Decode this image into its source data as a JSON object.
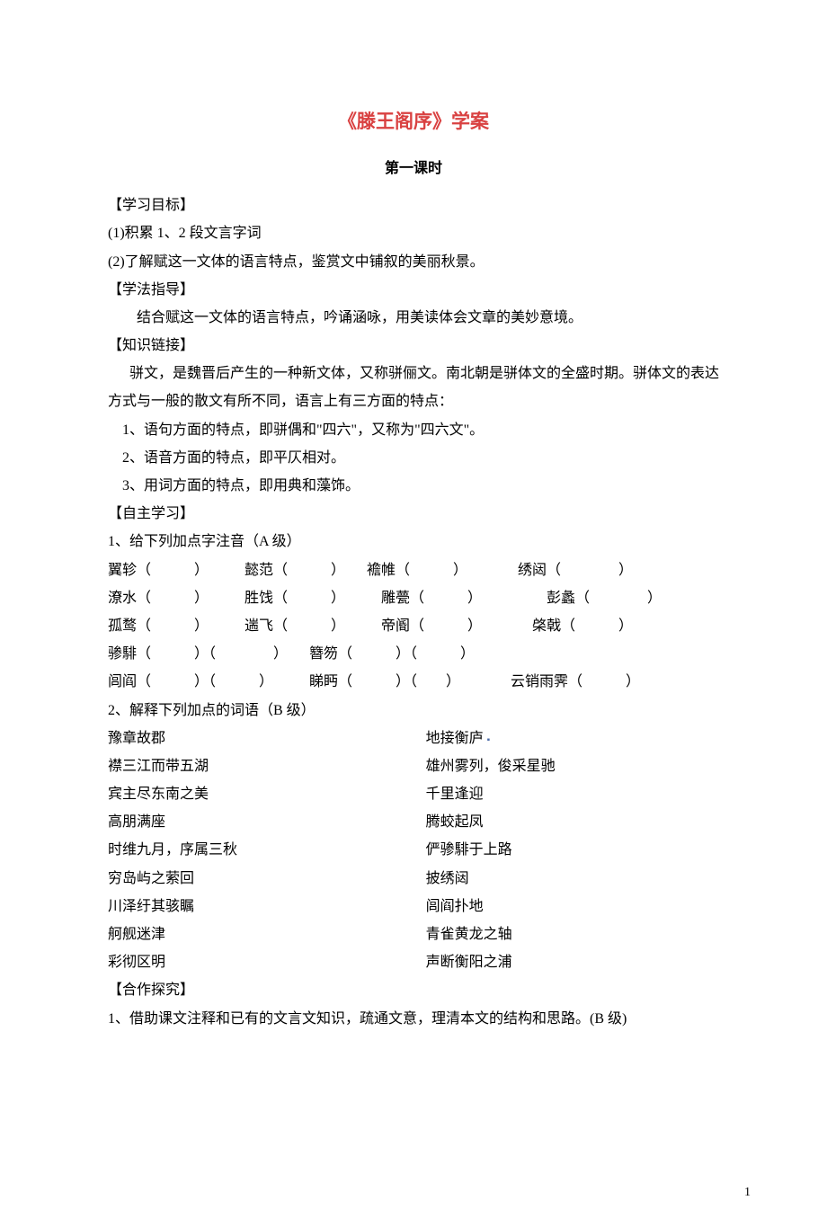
{
  "title": "《滕王阁序》学案",
  "subtitle": "第一课时",
  "headings": {
    "goals": "【学习目标】",
    "method": "【学法指导】",
    "knowledge": "【知识链接】",
    "self": "【自主学习】",
    "collab": "【合作探究】"
  },
  "goals": {
    "item1": "(1)积累 1、2 段文言字词",
    "item2": "(2)了解赋这一文体的语言特点，鉴赏文中铺叙的美丽秋景。"
  },
  "method": {
    "text": "结合赋这一文体的语言特点，吟诵涵咏，用美读体会文章的美妙意境。"
  },
  "knowledge": {
    "intro": "骈文，是魏晋后产生的一种新文体，又称骈俪文。南北朝是骈体文的全盛时期。骈体文的表达方式与一般的散文有所不同，语言上有三方面的特点：",
    "point1": "1、语句方面的特点，即骈偶和\"四六\"，又称为\"四六文\"。",
    "point2": "2、语音方面的特点，即平仄相对。",
    "point3": "3、用词方面的特点，即用典和藻饰。"
  },
  "self": {
    "prompt1": "1、给下列加点字注音（A 级）",
    "pinyin": {
      "r1": "翼轸（　　　）　　　懿范（　　　）　　襜帷（　　　）　　　　绣闼（　　　　）",
      "r2": "潦水（　　　）　　　胜饯（　　　）　　　雕甍（　　　）　　　　　彭蠡（　　　　）",
      "r3": "孤鹜（　　　）　　　遄飞（　　　）　　　帝阍（　　　）　　　　棨戟（　　　）",
      "r4": "骖騑（　　　）（　　　　）　　簪笏（　　　）（　　　）",
      "r5": "闾阎（　　　）（　　　）　　　睇眄（　　　）（　　）　　　　云销雨霁（　　　）"
    },
    "prompt2": "2、解释下列加点的词语（B 级）",
    "explain": [
      {
        "l": "豫章故郡",
        "r": "地接衡庐"
      },
      {
        "l": "襟三江而带五湖",
        "r": "雄州雾列，俊采星驰"
      },
      {
        "l": "宾主尽东南之美",
        "r": "千里逢迎"
      },
      {
        "l": "高朋满座",
        "r": "腾蛟起凤"
      },
      {
        "l": "时维九月，序属三秋",
        "r": "俨骖騑于上路"
      },
      {
        "l": "穷岛屿之萦回",
        "r": "披绣闼"
      },
      {
        "l": "川泽纡其骇瞩",
        "r": "闾阎扑地"
      },
      {
        "l": "舸舰迷津",
        "r": "青雀黄龙之轴"
      },
      {
        "l": "彩彻区明",
        "r": "声断衡阳之浦"
      }
    ]
  },
  "collab": {
    "item1": "1、借助课文注释和已有的文言文知识，疏通文意，理清本文的结构和思路。(B 级)"
  },
  "pageNumber": "1"
}
